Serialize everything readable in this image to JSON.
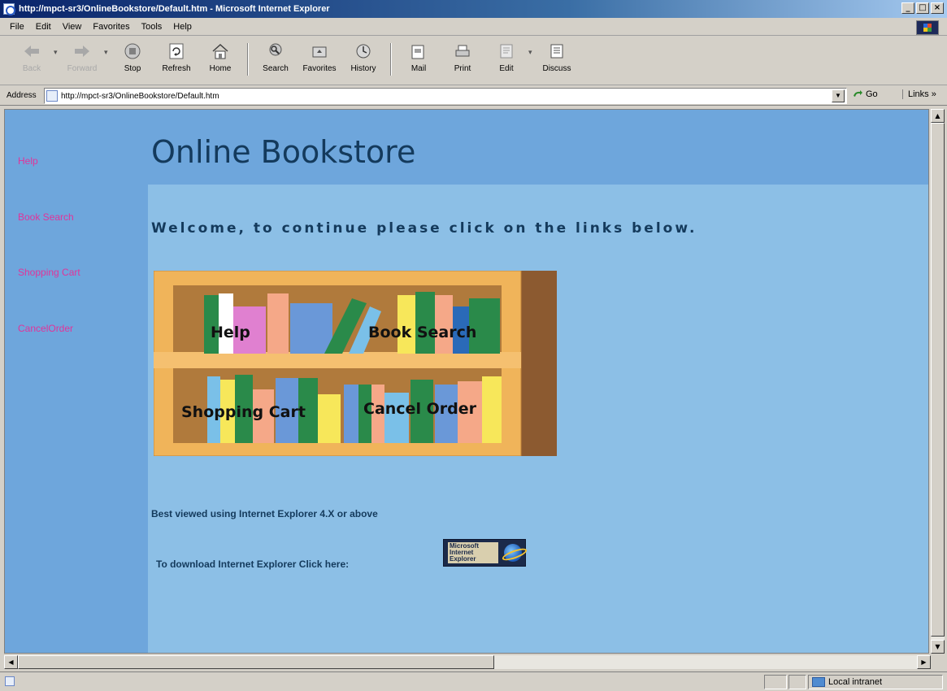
{
  "window": {
    "title": "http://mpct-sr3/OnlineBookstore/Default.htm - Microsoft Internet Explorer",
    "controls": [
      "_",
      "□",
      "×"
    ]
  },
  "menu": [
    "File",
    "Edit",
    "View",
    "Favorites",
    "Tools",
    "Help"
  ],
  "toolbar": {
    "back": "Back",
    "forward": "Forward",
    "stop": "Stop",
    "refresh": "Refresh",
    "home": "Home",
    "search": "Search",
    "favorites": "Favorites",
    "history": "History",
    "mail": "Mail",
    "print": "Print",
    "edit": "Edit",
    "discuss": "Discuss"
  },
  "address": {
    "label": "Address",
    "url": "http://mpct-sr3/OnlineBookstore/Default.htm",
    "go": "Go",
    "links": "Links »"
  },
  "nav": [
    "Help",
    "Book Search",
    "Shopping Cart",
    "CancelOrder"
  ],
  "page": {
    "title": "Online Bookstore",
    "welcome": "Welcome, to continue please click on the links below.",
    "shelf": {
      "help": "Help",
      "book_search": "Book Search",
      "shopping_cart": "Shopping Cart",
      "cancel_order": "Cancel Order"
    },
    "best_viewed": "Best viewed using Internet Explorer 4.X or above",
    "download": "To download Internet Explorer Click here:",
    "ie_logo": [
      "Microsoft",
      "Internet",
      "Explorer"
    ]
  },
  "status": {
    "zone": "Local intranet"
  },
  "colors": {
    "page_bg": "#8cbfe6",
    "nav_bg": "#6ea6dc",
    "nav_link": "#e0349a",
    "heading": "#143a5c",
    "shelf_wood": "#f0b45a"
  }
}
